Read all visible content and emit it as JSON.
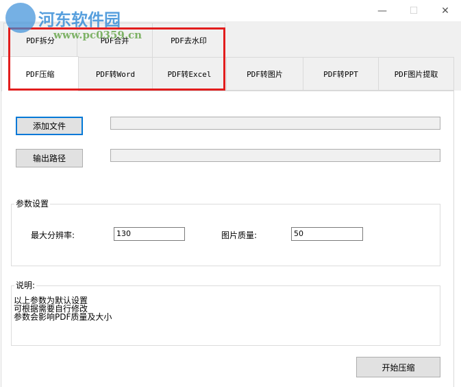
{
  "watermark": {
    "name": "河东软件园",
    "url": "www.pc0359.cn"
  },
  "window_controls": {
    "minimize": "—",
    "maximize": "☐",
    "close": "✕"
  },
  "tabs_row1": [
    "PDF拆分",
    "PDF合并",
    "PDF去水印"
  ],
  "tabs_row2": [
    "PDF压缩",
    "PDF转Word",
    "PDF转Excel",
    "PDF转图片",
    "PDF转PPT",
    "PDF图片提取"
  ],
  "selected_tab": "PDF压缩",
  "buttons": {
    "add_file": "添加文件",
    "output_path": "输出路径",
    "start": "开始压缩"
  },
  "fields": {
    "add_file_path": "",
    "output_path": ""
  },
  "params": {
    "title": "参数设置",
    "max_resolution_label": "最大分辨率:",
    "max_resolution": "130",
    "quality_label": "图片质量:",
    "quality": "50"
  },
  "notes": {
    "title": "说明:",
    "lines": [
      "以上参数为默认设置",
      "可根据需要自行修改",
      "参数会影响PDF质量及大小"
    ]
  },
  "highlight_color": "#e21d1d"
}
